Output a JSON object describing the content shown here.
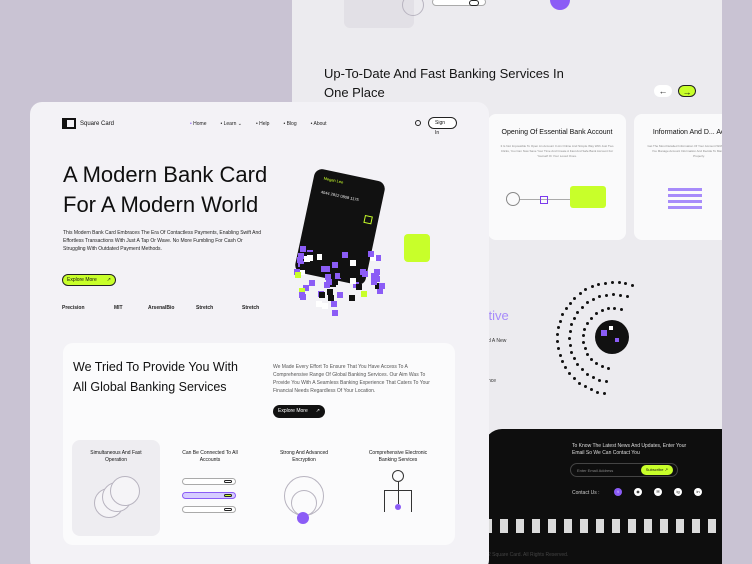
{
  "back": {
    "section_title": "Up-To-Date And Fast Banking Services In One Place",
    "prev_arrow": "←",
    "next_arrow": "→",
    "cards": [
      {
        "title": "Opening Of Essential Bank Account",
        "text": "It Is Not Impossible To Open An Account In An Online And Simple Way With Just Two Clicks, You Can Now Save Your Time And Create A Fast And Safe Bank Account For Yourself Or Your Loved Ones."
      },
      {
        "title": "Information And D... Accounts",
        "text": "Get The Most Detailed Information Of Your Account Without Detecting Money, You Manage Account Information And Decide To Manage Your Account Properly."
      }
    ],
    "partial_word": "ctive",
    "partial_lines": [
      "d A New",
      "nce"
    ],
    "newsletter_text": "To Know The Latest News And Updates, Enter Your Email So We Can Contact You",
    "email_placeholder": "Enter Email Address",
    "subscribe_label": "Subscribe",
    "subscribe_arrow": "↗",
    "contact_label": "Contact Us :",
    "socials": [
      "t",
      "◉",
      "✉",
      "ig",
      "in"
    ],
    "copyright": "2 Square Card. All Rights Reserved."
  },
  "nav": {
    "brand": "Square Card",
    "items": [
      "Home",
      "Learn",
      "Help",
      "Blog",
      "About"
    ],
    "signin": "Sign In"
  },
  "hero": {
    "title": "A Modern Bank Card For A Modern World",
    "text": "This Modern Bank Card Embraces The Era Of Contactless Payments, Enabling Swift And Effortless Transactions With Just A Tap Or Wave. No More Fumbling For Cash Or Struggling With Outdated Payment Methods.",
    "cta": "Explore More",
    "cta_arrow": "↗",
    "brands": [
      "Precision",
      "MIT",
      "ArsenalBio",
      "Stretch",
      "Stretch"
    ],
    "card_name": "Megan Lee",
    "card_number": "4044 2822 0808 1175"
  },
  "section2": {
    "title": "We Tried To Provide You With All Global Banking Services",
    "text": "We Made Every Effort To Ensure That You Have Access To A Comprehensive Range Of Global Banking Services. Our Aim Was To Provide You With A Seamless Banking Experience That Caters To Your Financial Needs Regardless Of Your Location.",
    "cta": "Explore More",
    "cta_arrow": "↗",
    "features": [
      "Simultaneous And Fast Operation",
      "Can Be Connected To All Accounts",
      "Strong And Advanced Encryption",
      "Comprehensive Electronic Banking Services"
    ]
  },
  "colors": {
    "accent_lime": "#c8ff2a",
    "accent_violet": "#8b5cf6",
    "dark": "#111111",
    "bg": "#c9c3d3"
  }
}
